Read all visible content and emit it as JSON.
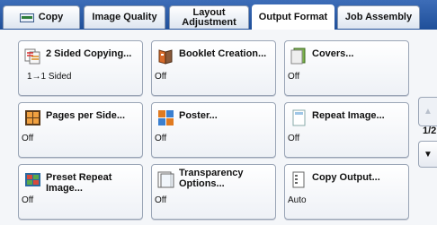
{
  "tabs": [
    {
      "label": "Copy"
    },
    {
      "label": "Image Quality"
    },
    {
      "label": "Layout\nAdjustment"
    },
    {
      "label": "Output Format"
    },
    {
      "label": "Job Assembly"
    }
  ],
  "buttons": [
    {
      "title": "2 Sided Copying...",
      "value": "1→1 Sided",
      "icon": "two-sided-copying-icon"
    },
    {
      "title": "Booklet Creation...",
      "value": "Off",
      "icon": "booklet-icon"
    },
    {
      "title": "Covers...",
      "value": "Off",
      "icon": "covers-icon"
    },
    {
      "title": "Pages per Side...",
      "value": "Off",
      "icon": "pages-per-side-icon"
    },
    {
      "title": "Poster...",
      "value": "Off",
      "icon": "poster-icon"
    },
    {
      "title": "Repeat Image...",
      "value": "Off",
      "icon": "repeat-image-icon"
    },
    {
      "title": "Preset Repeat Image...",
      "value": "Off",
      "icon": "preset-repeat-image-icon"
    },
    {
      "title": "Transparency\nOptions...",
      "value": "Off",
      "icon": "transparency-icon"
    },
    {
      "title": "Copy Output...",
      "value": "Auto",
      "icon": "copy-output-icon"
    }
  ],
  "pager": {
    "indicator": "1/2",
    "up": "▲",
    "down": "▼"
  },
  "colors": {
    "tab_bar": "#2a5aa6",
    "active_tab": "#ffffff",
    "panel": "#f4f6f9"
  }
}
